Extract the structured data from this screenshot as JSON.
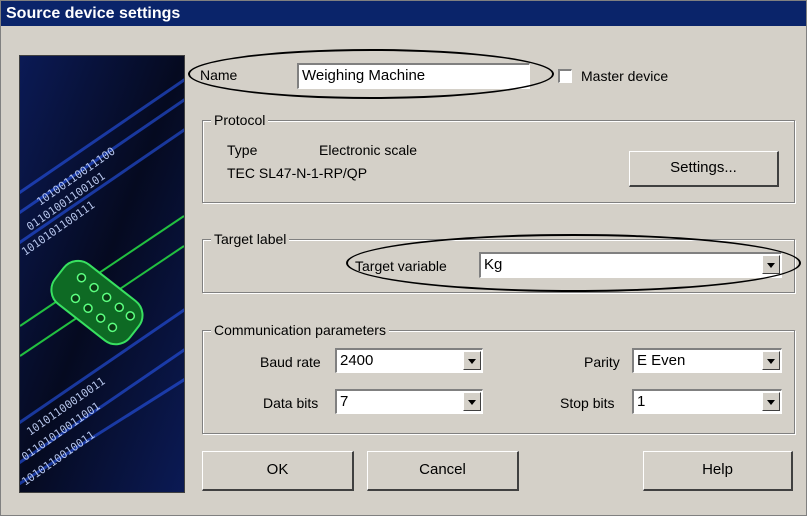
{
  "window": {
    "title": "Source device settings"
  },
  "name_row": {
    "label": "Name",
    "value": "Weighing Machine",
    "master_label": "Master device",
    "master_checked": false
  },
  "protocol": {
    "group_title": "Protocol",
    "type_label": "Type",
    "type_value": "Electronic scale",
    "model": "TEC SL47-N-1-RP/QP",
    "settings_button": "Settings..."
  },
  "target": {
    "group_title": "Target label",
    "variable_label": "Target variable",
    "variable_value": "Kg"
  },
  "comm": {
    "group_title": "Communication parameters",
    "baud_label": "Baud rate",
    "baud_value": "2400",
    "data_bits_label": "Data bits",
    "data_bits_value": "7",
    "parity_label": "Parity",
    "parity_value": "E Even",
    "stop_bits_label": "Stop bits",
    "stop_bits_value": "1"
  },
  "buttons": {
    "ok": "OK",
    "cancel": "Cancel",
    "help": "Help"
  }
}
